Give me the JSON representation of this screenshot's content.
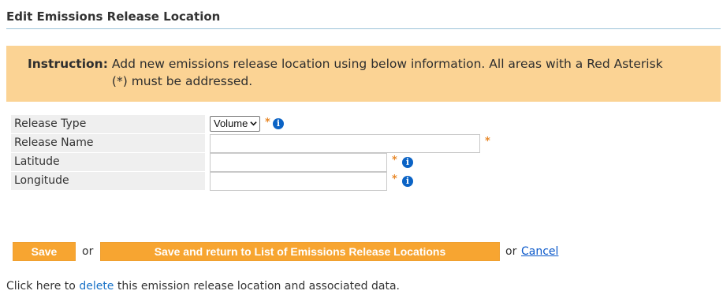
{
  "page": {
    "title": "Edit Emissions Release Location"
  },
  "instruction": {
    "label": "Instruction:",
    "text": "Add new emissions release location using below information. All areas with a Red Asterisk (*) must be addressed."
  },
  "form": {
    "release_type": {
      "label": "Release Type",
      "value": "Volume",
      "required": "*"
    },
    "release_name": {
      "label": "Release Name",
      "value": "",
      "required": "*"
    },
    "latitude": {
      "label": "Latitude",
      "value": "",
      "required": "*"
    },
    "longitude": {
      "label": "Longitude",
      "value": "",
      "required": "*"
    },
    "info_glyph": "i"
  },
  "actions": {
    "save_label": "Save",
    "or1": "or",
    "save_return_label": "Save and return to List of Emissions Release Locations",
    "or2": "or",
    "cancel_label": "Cancel"
  },
  "footer": {
    "prefix": "Click here to ",
    "delete_link": "delete",
    "suffix": " this emission release location and associated data."
  },
  "colors": {
    "instruction_bg": "#fbd394",
    "button_bg": "#f7a531",
    "asterisk": "#e8892a",
    "info_icon": "#0b63c5",
    "link": "#0a58ca"
  }
}
